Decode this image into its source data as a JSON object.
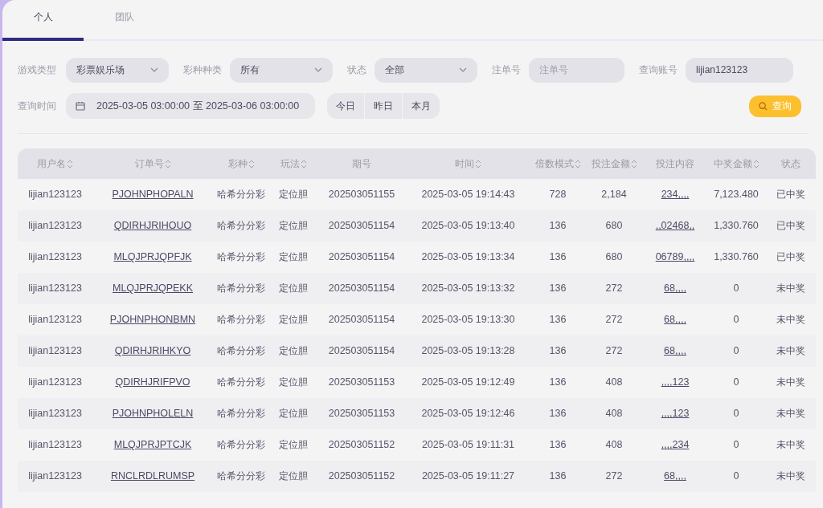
{
  "tabs": [
    {
      "label": "个人",
      "selected": true
    },
    {
      "label": "团队",
      "selected": false
    }
  ],
  "filters": [
    {
      "kind": "select",
      "label": "游戏类型",
      "value": "彩票娱乐场"
    },
    {
      "kind": "select",
      "label": "彩种种类",
      "value": "所有"
    },
    {
      "kind": "select",
      "label": "状态",
      "value": "全部"
    },
    {
      "kind": "input",
      "label": "注单号",
      "placeholder": "注单号"
    },
    {
      "kind": "input",
      "label": "查询账号",
      "value": "lijian123123"
    }
  ],
  "date_range": {
    "label": "查询时间",
    "value": "2025-03-05 03:00:00 至 2025-03-06 03:00:00"
  },
  "quick_ranges": [
    "今日",
    "昨日",
    "本月"
  ],
  "search_button": "查询",
  "table": {
    "columns": [
      {
        "label": "用户名",
        "sortable": true
      },
      {
        "label": "订单号",
        "sortable": true
      },
      {
        "label": "彩种",
        "sortable": true
      },
      {
        "label": "玩法",
        "sortable": true
      },
      {
        "label": "期号",
        "sortable": false
      },
      {
        "label": "时间",
        "sortable": true
      },
      {
        "label": "倍数模式",
        "sortable": true
      },
      {
        "label": "投注金额",
        "sortable": true
      },
      {
        "label": "投注内容",
        "sortable": false
      },
      {
        "label": "中奖金额",
        "sortable": true
      },
      {
        "label": "状态",
        "sortable": false
      }
    ],
    "rows": [
      [
        "lijian123123",
        "PJOHNPHOPALN",
        "哈希分分彩",
        "定位胆",
        "202503051155",
        "2025-03-05 19:14:43",
        "728",
        "2,184",
        "234,,,,",
        "7,123.480",
        "已中奖"
      ],
      [
        "lijian123123",
        "QDIRHJRIHOUO",
        "哈希分分彩",
        "定位胆",
        "202503051154",
        "2025-03-05 19:13:40",
        "136",
        "680",
        ",,02468,,",
        "1,330.760",
        "已中奖"
      ],
      [
        "lijian123123",
        "MLQJPRJQPFJK",
        "哈希分分彩",
        "定位胆",
        "202503051154",
        "2025-03-05 19:13:34",
        "136",
        "680",
        "06789,,,,",
        "1,330.760",
        "已中奖"
      ],
      [
        "lijian123123",
        "MLQJPRJQPEKK",
        "哈希分分彩",
        "定位胆",
        "202503051154",
        "2025-03-05 19:13:32",
        "136",
        "272",
        "68,,,,",
        "0",
        "未中奖"
      ],
      [
        "lijian123123",
        "PJOHNPHONBMN",
        "哈希分分彩",
        "定位胆",
        "202503051154",
        "2025-03-05 19:13:30",
        "136",
        "272",
        "68,,,,",
        "0",
        "未中奖"
      ],
      [
        "lijian123123",
        "QDIRHJRIHKYO",
        "哈希分分彩",
        "定位胆",
        "202503051154",
        "2025-03-05 19:13:28",
        "136",
        "272",
        "68,,,,",
        "0",
        "未中奖"
      ],
      [
        "lijian123123",
        "QDIRHJRIFPVO",
        "哈希分分彩",
        "定位胆",
        "202503051153",
        "2025-03-05 19:12:49",
        "136",
        "408",
        ",,,,123",
        "0",
        "未中奖"
      ],
      [
        "lijian123123",
        "PJOHNPHOLELN",
        "哈希分分彩",
        "定位胆",
        "202503051153",
        "2025-03-05 19:12:46",
        "136",
        "408",
        ",,,,123",
        "0",
        "未中奖"
      ],
      [
        "lijian123123",
        "MLQJPRJPTCJK",
        "哈希分分彩",
        "定位胆",
        "202503051152",
        "2025-03-05 19:11:31",
        "136",
        "408",
        ",,,,234",
        "0",
        "未中奖"
      ],
      [
        "lijian123123",
        "RNCLRDLRUMSP",
        "哈希分分彩",
        "定位胆",
        "202503051152",
        "2025-03-05 19:11:27",
        "136",
        "272",
        "68,,,,",
        "0",
        "未中奖"
      ]
    ]
  }
}
